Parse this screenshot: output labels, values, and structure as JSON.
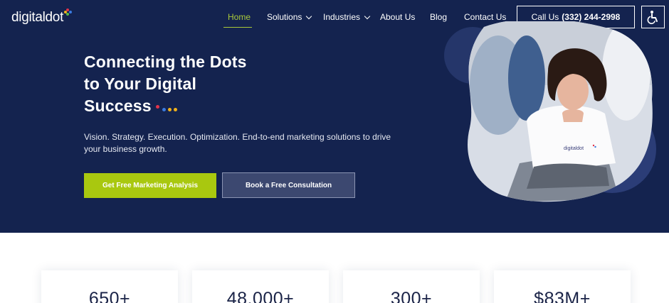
{
  "brand": {
    "name": "digitaldot",
    "dot_colors": [
      "#e3344a",
      "#3a7be0",
      "#f2b21b",
      "#53b948"
    ]
  },
  "nav": {
    "items": [
      {
        "label": "Home",
        "active": true,
        "has_dropdown": false
      },
      {
        "label": "Solutions",
        "active": false,
        "has_dropdown": true
      },
      {
        "label": "Industries",
        "active": false,
        "has_dropdown": true
      },
      {
        "label": "About Us",
        "active": false,
        "has_dropdown": false
      },
      {
        "label": "Blog",
        "active": false,
        "has_dropdown": false
      },
      {
        "label": "Contact Us",
        "active": false,
        "has_dropdown": false
      }
    ],
    "call": {
      "label": "Call Us",
      "phone": "(332) 244-2998"
    },
    "accessibility_icon": "accessibility-icon"
  },
  "hero": {
    "headline_lines": [
      "Connecting the Dots",
      "to Your Digital",
      "Success"
    ],
    "subtitle": "Vision. Strategy. Execution. Optimization. End-to-end marketing solutions to drive your business growth.",
    "primary_cta": "Get Free Marketing Analysis",
    "secondary_cta": "Book a Free Consultation",
    "shirt_logo": "digitaldot",
    "dot_colors": [
      "#e3344a",
      "#3a7be0",
      "#f2b21b",
      "#f2b21b"
    ]
  },
  "stats": [
    {
      "value": "650+"
    },
    {
      "value": "48,000+"
    },
    {
      "value": "300+"
    },
    {
      "value": "$83M+"
    }
  ],
  "colors": {
    "navy": "#14234f",
    "accent_green": "#a9c80f",
    "nav_active": "#a9c93a"
  }
}
